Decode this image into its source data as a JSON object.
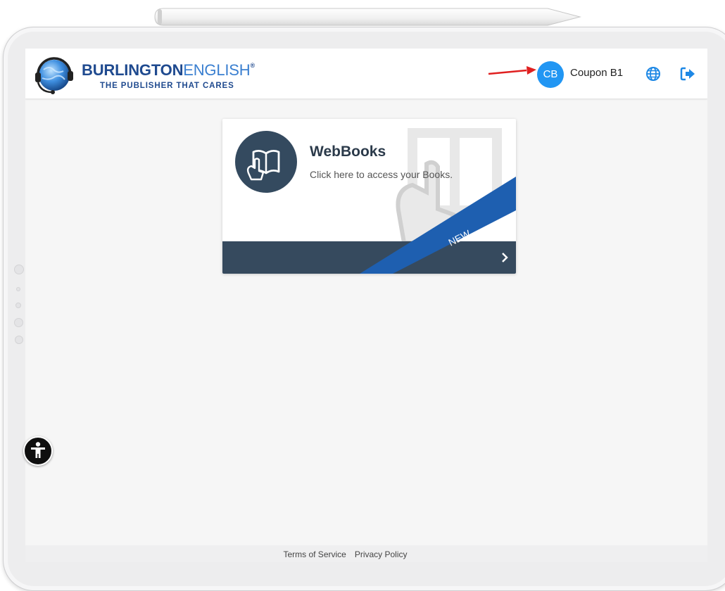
{
  "header": {
    "brand_bold": "BURLINGTON",
    "brand_light": "ENGLISH",
    "brand_mark": "®",
    "tagline": "THE PUBLISHER THAT CARES",
    "avatar_initials": "CB",
    "username": "Coupon B1",
    "globe_icon": "globe-icon",
    "logout_icon": "logout-icon"
  },
  "card": {
    "title": "WebBooks",
    "description": "Click here to access your Books.",
    "ribbon_label": "NEW",
    "icon": "book-hand-icon",
    "footer_icon": "chevron-right-icon"
  },
  "footer": {
    "terms": "Terms of Service",
    "privacy": "Privacy Policy"
  },
  "accessibility": {
    "icon": "accessibility-icon"
  },
  "colors": {
    "accent": "#2196f3",
    "brand_dark": "#1f4a8f",
    "card_footer": "#364a5e",
    "ribbon": "#1e5fb0",
    "annotation_arrow": "#e02020"
  }
}
